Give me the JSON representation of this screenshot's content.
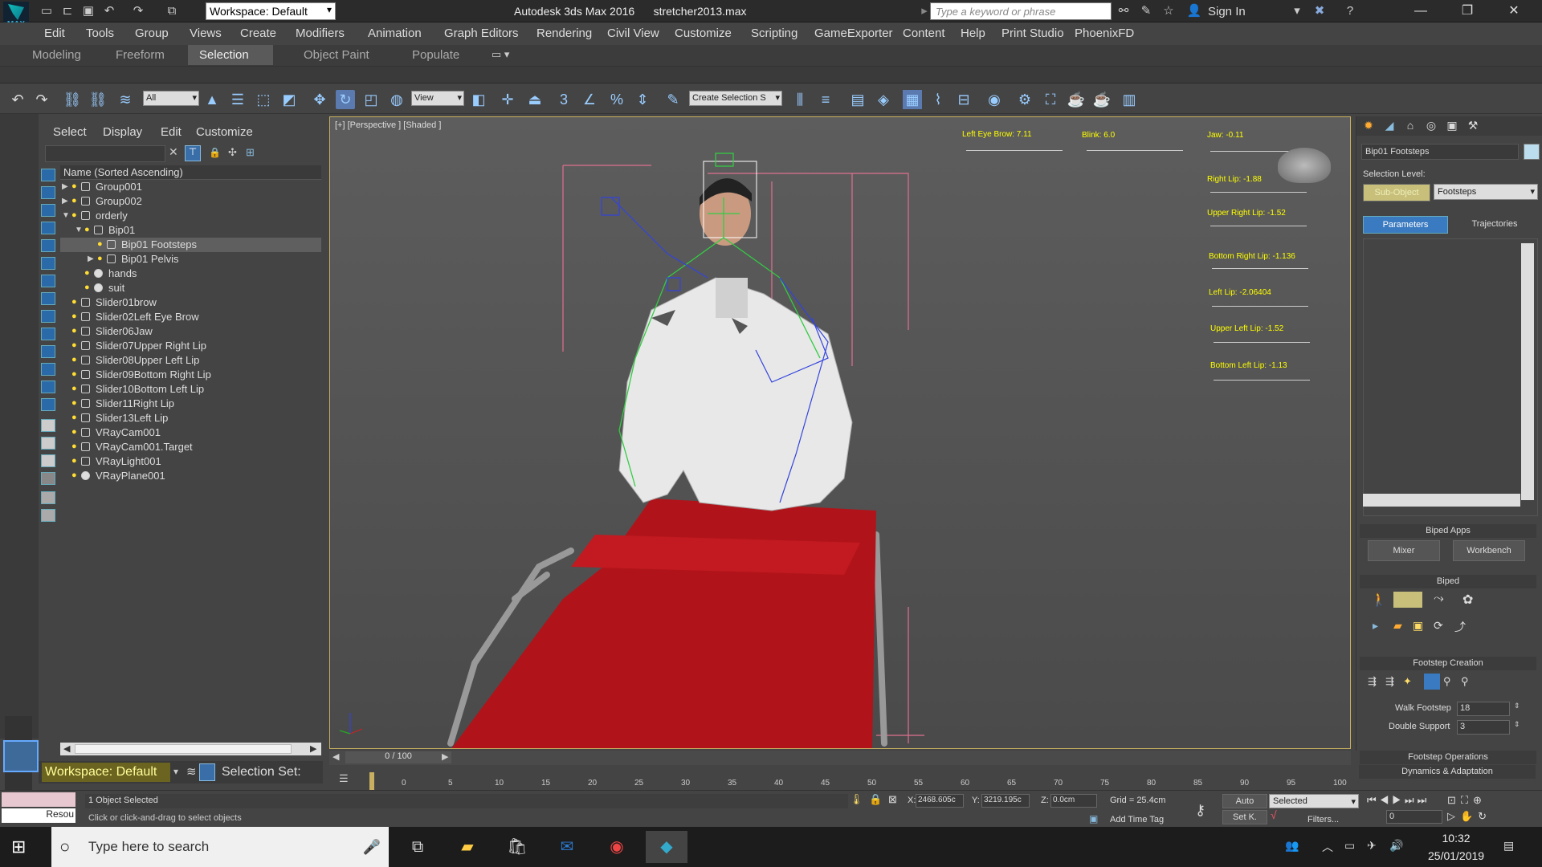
{
  "titlebar": {
    "app_logo": "MAX",
    "workspace": "Workspace: Default",
    "app_name": "Autodesk 3ds Max 2016",
    "file_name": "stretcher2013.max",
    "search_placeholder": "Type a keyword or phrase",
    "sign_in": "Sign In"
  },
  "menu": [
    "Edit",
    "Tools",
    "Group",
    "Views",
    "Create",
    "Modifiers",
    "Animation",
    "Graph Editors",
    "Rendering",
    "Civil View",
    "Customize",
    "Scripting",
    "GameExporter",
    "Content",
    "Help",
    "Print Studio",
    "PhoenixFD"
  ],
  "ribbon_tabs": [
    "Modeling",
    "Freeform",
    "Selection",
    "Object Paint",
    "Populate"
  ],
  "toolbar": {
    "filter": "All",
    "coord": "View",
    "selection_set": "Create Selection S"
  },
  "scene": {
    "menu": [
      "Select",
      "Display",
      "Edit",
      "Customize"
    ],
    "column_header": "Name (Sorted Ascending)",
    "items": [
      {
        "label": "Group001"
      },
      {
        "label": "Group002"
      },
      {
        "label": "orderly"
      },
      {
        "label": "Bip01"
      },
      {
        "label": "Bip01 Footsteps"
      },
      {
        "label": "Bip01 Pelvis"
      },
      {
        "label": "hands"
      },
      {
        "label": "suit"
      },
      {
        "label": "Slider01brow"
      },
      {
        "label": "Slider02Left Eye Brow"
      },
      {
        "label": "Slider06Jaw"
      },
      {
        "label": "Slider07Upper Right Lip"
      },
      {
        "label": "Slider08Upper Left Lip"
      },
      {
        "label": "Slider09Bottom Right Lip"
      },
      {
        "label": "Slider10Bottom Left Lip"
      },
      {
        "label": "Slider11Right Lip"
      },
      {
        "label": "Slider13Left Lip"
      },
      {
        "label": "VRayCam001"
      },
      {
        "label": "VRayCam001.Target"
      },
      {
        "label": "VRayLight001"
      },
      {
        "label": "VRayPlane001"
      }
    ],
    "workspace": "Workspace: Default",
    "selection_set": "Selection Set:"
  },
  "viewport": {
    "label": "[+] [Perspective ] [Shaded ]",
    "sliders": [
      {
        "label": "Left Eye Brow: 7.11"
      },
      {
        "label": "Blink: 6.0"
      },
      {
        "label": "Jaw: -0.11"
      },
      {
        "label": "Right Lip: -1.88"
      },
      {
        "label": "Upper Right Lip: -1.52"
      },
      {
        "label": "Bottom Right Lip: -1.136"
      },
      {
        "label": "Left Lip: -2.06404"
      },
      {
        "label": "Upper Left Lip: -1.52"
      },
      {
        "label": "Bottom Left Lip: -1.13"
      }
    ]
  },
  "command_panel": {
    "object_name": "Bip01 Footsteps",
    "selection_level_label": "Selection Level:",
    "sub_object": "Sub-Object",
    "level_value": "Footsteps",
    "tab_parameters": "Parameters",
    "tab_trajectories": "Trajectories",
    "biped_apps": "Biped Apps",
    "mixer": "Mixer",
    "workbench": "Workbench",
    "biped": "Biped",
    "footstep_creation": "Footstep Creation",
    "walk_footstep_label": "Walk Footstep",
    "walk_footstep_value": "18",
    "double_support_label": "Double Support",
    "double_support_value": "3",
    "footstep_operations": "Footstep Operations",
    "dynamics": "Dynamics & Adaptation"
  },
  "timeline": {
    "frame": "0 / 100",
    "ticks": [
      "0",
      "5",
      "10",
      "15",
      "20",
      "25",
      "30",
      "35",
      "40",
      "45",
      "50",
      "55",
      "60",
      "65",
      "70",
      "75",
      "80",
      "85",
      "90",
      "95",
      "100"
    ]
  },
  "status": {
    "maxscript": "Resou",
    "objects_selected": "1 Object Selected",
    "prompt": "Click or click-and-drag to select objects",
    "x_label": "X:",
    "x_value": "2468.605c",
    "y_label": "Y:",
    "y_value": "3219.195c",
    "z_label": "Z:",
    "z_value": "0.0cm",
    "grid": "Grid = 25.4cm",
    "add_time_tag": "Add Time Tag",
    "auto": "Auto",
    "set_key": "Set K.",
    "key_filter": "Selected",
    "filters": "Filters...",
    "frame_value": "0"
  },
  "taskbar": {
    "search_placeholder": "Type here to search",
    "time": "10:32",
    "date": "25/01/2019"
  }
}
